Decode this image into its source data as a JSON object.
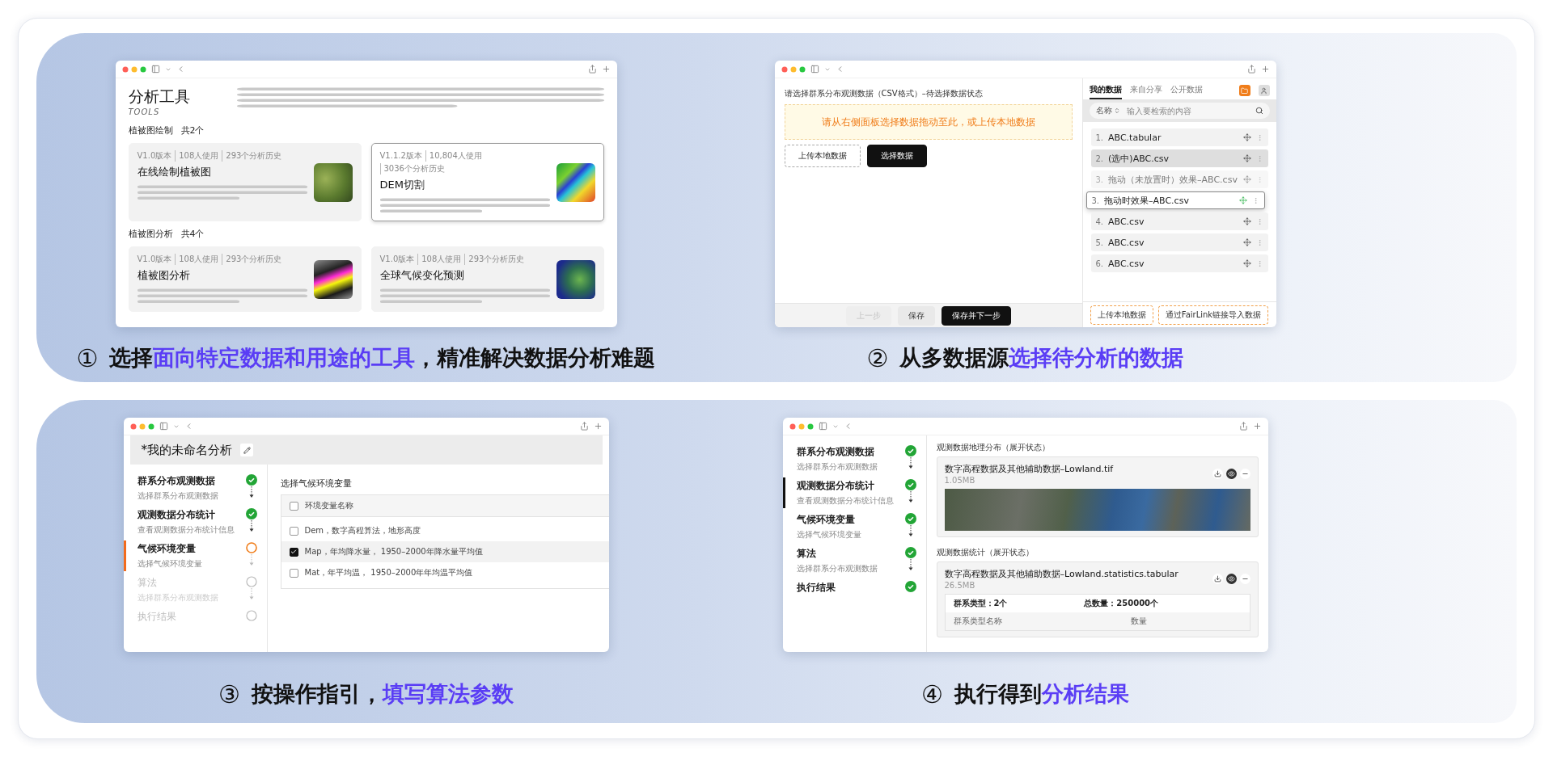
{
  "panels": [
    {
      "kind": "tools",
      "number": "①",
      "caption": [
        {
          "text": "选择",
          "highlight": false
        },
        {
          "text": "面向特定数据和用途的工具",
          "highlight": true
        },
        {
          "text": "，精准解决数据分析难题",
          "highlight": false
        }
      ],
      "screen": {
        "title": "分析工具",
        "subtitle": "TOOLS",
        "sections": [
          {
            "title": "植被图绘制",
            "count": "共2个",
            "cards": [
              {
                "meta": [
                  "V1.0版本",
                  "108人使用",
                  "293个分析历史"
                ],
                "title": "在线绘制植被图",
                "selected": false
              },
              {
                "meta": [
                  "V1.1.2版本",
                  "10,804人使用",
                  "3036个分析历史"
                ],
                "title": "DEM切割",
                "selected": true
              }
            ]
          },
          {
            "title": "植被图分析",
            "count": "共4个",
            "cards": [
              {
                "meta": [
                  "V1.0版本",
                  "108人使用",
                  "293个分析历史"
                ],
                "title": "植被图分析",
                "selected": false
              },
              {
                "meta": [
                  "V1.0版本",
                  "108人使用",
                  "293个分析历史"
                ],
                "title": "全球气候变化预测",
                "selected": false
              }
            ]
          }
        ]
      }
    },
    {
      "kind": "data_picker",
      "number": "②",
      "caption": [
        {
          "text": "从多数据源",
          "highlight": false
        },
        {
          "text": "选择待分析的数据",
          "highlight": true
        }
      ],
      "screen": {
        "prompt": "请选择群系分布观测数据（CSV格式）–待选择数据状态",
        "drop_hint": "请从右侧面板选择数据拖动至此，或上传本地数据",
        "actions": [
          {
            "label": "上传本地数据",
            "kind": "outline"
          },
          {
            "label": "选择数据",
            "kind": "primary"
          }
        ],
        "footer": [
          {
            "label": "上一步",
            "kind": "disabled"
          },
          {
            "label": "保存",
            "kind": "plain"
          },
          {
            "label": "保存并下一步",
            "kind": "primary"
          }
        ],
        "tabs": [
          {
            "label": "我的数据",
            "selected": true
          },
          {
            "label": "来自分享",
            "selected": false
          },
          {
            "label": "公开数据",
            "selected": false
          }
        ],
        "filter": "名称",
        "search_placeholder": "输入要检索的内容",
        "files": [
          {
            "index": "1.",
            "name": "ABC.tabular",
            "kind": "normal",
            "selected": false
          },
          {
            "index": "2.",
            "name": "(选中)ABC.csv",
            "kind": "normal",
            "selected": true
          },
          {
            "index": "3.",
            "name": "拖动（未放置时）效果–ABC.csv",
            "kind": "ghost",
            "selected": false
          },
          {
            "index": "3.",
            "name": "拖动时效果–ABC.csv",
            "kind": "dragging",
            "selected": false
          },
          {
            "index": "4.",
            "name": "ABC.csv",
            "kind": "normal",
            "selected": false
          },
          {
            "index": "5.",
            "name": "ABC.csv",
            "kind": "normal",
            "selected": false
          },
          {
            "index": "6.",
            "name": "ABC.csv",
            "kind": "normal",
            "selected": false
          }
        ],
        "side_actions": [
          "上传本地数据",
          "通过FairLink链接导入数据"
        ]
      }
    },
    {
      "kind": "params",
      "number": "③",
      "caption": [
        {
          "text": "按操作指引，",
          "highlight": false
        },
        {
          "text": "填写算法参数",
          "highlight": true
        }
      ],
      "screen": {
        "title": "*我的未命名分析",
        "steps": [
          {
            "title": "群系分布观测数据",
            "subtitle": "选择群系分布观测数据",
            "done": true,
            "current": false,
            "selected": false
          },
          {
            "title": "观测数据分布统计",
            "subtitle": "查看观测数据分布统计信息",
            "done": true,
            "current": false,
            "selected": false
          },
          {
            "title": "气候环境变量",
            "subtitle": "选择气候环境变量",
            "done": false,
            "current": true,
            "selected": true
          },
          {
            "title": "算法",
            "subtitle": "选择群系分布观测数据",
            "done": false,
            "current": false,
            "selected": false
          },
          {
            "title": "执行结果",
            "done": false,
            "current": false,
            "selected": false
          }
        ],
        "heading": "选择气候环境变量",
        "header": {
          "label": "环境变量名称",
          "checked": false
        },
        "options": [
          {
            "label": "Dem，数字高程算法，地形高度",
            "checked": false
          },
          {
            "label": "Map，年均降水量， 1950–2000年降水量平均值",
            "checked": true
          },
          {
            "label": "Mat，年平均温， 1950–2000年年均温平均值",
            "checked": false
          }
        ]
      }
    },
    {
      "kind": "results",
      "number": "④",
      "caption": [
        {
          "text": "执行得到",
          "highlight": false
        },
        {
          "text": "分析结果",
          "highlight": true
        }
      ],
      "screen": {
        "steps": [
          {
            "title": "群系分布观测数据",
            "subtitle": "选择群系分布观测数据",
            "done": true,
            "current": false,
            "selected": false
          },
          {
            "title": "观测数据分布统计",
            "subtitle": "查看观测数据分布统计信息",
            "done": true,
            "current": false,
            "selected": true
          },
          {
            "title": "气候环境变量",
            "subtitle": "选择气候环境变量",
            "done": true,
            "current": false,
            "selected": false
          },
          {
            "title": "算法",
            "subtitle": "选择群系分布观测数据",
            "done": true,
            "current": false,
            "selected": false
          },
          {
            "title": "执行结果",
            "done": true,
            "current": false,
            "selected": false
          }
        ],
        "sections": [
          {
            "heading": "观测数据地理分布（展开状态）",
            "file": "数字高程数据及其他辅助数据–Lowland.tif",
            "size": "1.05MB",
            "kind": "map"
          },
          {
            "heading": "观测数据统计（展开状态）",
            "file": "数字高程数据及其他辅助数据–Lowland.statistics.tabular",
            "size": "26.5MB",
            "kind": "table",
            "summary": [
              "群系类型：2个",
              "总数量：250000个"
            ],
            "columns": [
              "群系类型名称",
              "数量"
            ]
          }
        ]
      }
    }
  ]
}
